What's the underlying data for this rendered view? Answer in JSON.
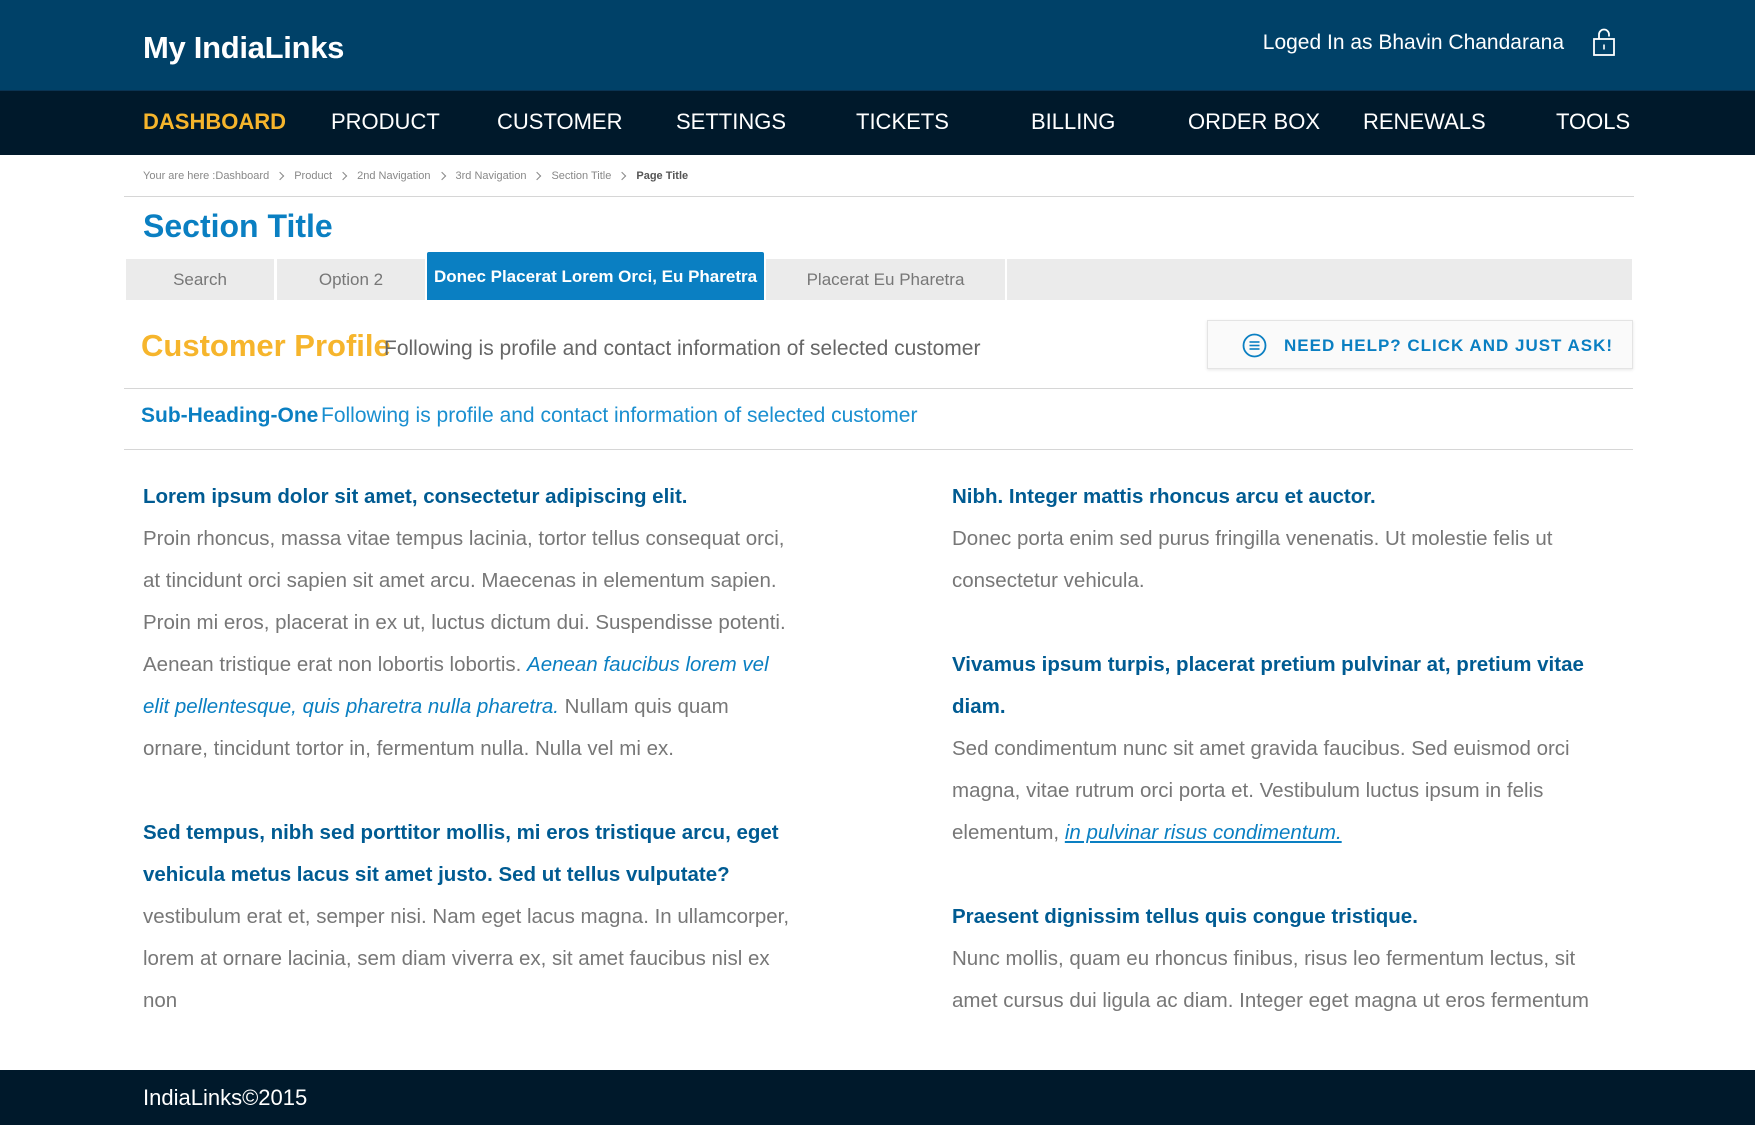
{
  "header": {
    "brand": "My IndiaLinks",
    "login_text": "Loged In as Bhavin Chandarana",
    "lock_icon": "lock-icon"
  },
  "nav": {
    "items": [
      {
        "label": "DASHBOARD",
        "active": true
      },
      {
        "label": "PRODUCT"
      },
      {
        "label": "CUSTOMER"
      },
      {
        "label": "SETTINGS"
      },
      {
        "label": "TICKETS"
      },
      {
        "label": "BILLING"
      },
      {
        "label": "ORDER BOX"
      },
      {
        "label": "RENEWALS"
      },
      {
        "label": "TOOLS"
      }
    ]
  },
  "breadcrumb": {
    "prefix": "Your are here : ",
    "items": [
      "Dashboard",
      "Product",
      "2nd Navigation",
      "3rd Navigation",
      "Section Title"
    ],
    "current": "Page Title"
  },
  "section_title": "Section Title",
  "tabs": [
    {
      "label": "Search"
    },
    {
      "label": "Option 2"
    },
    {
      "label": "Donec Placerat Lorem Orci, Eu Pharetra",
      "active": true
    },
    {
      "label": "Placerat Eu Pharetra"
    }
  ],
  "profile": {
    "title": "Customer Profile",
    "description": "Following is profile and contact information of selected customer",
    "help_label": "NEED HELP? CLICK AND JUST ASK!",
    "help_icon": "chat-list-icon"
  },
  "sub": {
    "heading": "Sub-Heading-One",
    "description": "Following is profile and contact information of selected customer"
  },
  "content": {
    "left": [
      {
        "heading": "Lorem ipsum dolor sit amet, consectetur adipiscing elit.",
        "text_before": "Proin rhoncus, massa vitae tempus lacinia, tortor tellus consequat orci, at tincidunt orci sapien sit amet arcu. Maecenas in elementum sapien. Proin mi eros, placerat in ex ut, luctus dictum dui. Suspendisse potenti. Aenean tristique erat non lobortis lobortis. ",
        "emphasis": "Aenean faucibus lorem vel elit pellentesque, quis pharetra nulla pharetra.",
        "text_after": " Nullam quis quam ornare, tincidunt tortor in, fermentum nulla. Nulla vel mi ex."
      },
      {
        "heading": "Sed tempus, nibh sed porttitor mollis, mi eros tristique arcu, eget vehicula metus lacus sit amet justo. Sed ut tellus vulputate?",
        "text": "vestibulum erat et, semper nisi. Nam eget lacus magna. In ullamcorper, lorem at ornare lacinia, sem diam viverra ex, sit amet faucibus nisl ex non"
      }
    ],
    "right": [
      {
        "heading": "Nibh. Integer mattis rhoncus arcu et auctor.",
        "text": "Donec porta enim sed purus fringilla venenatis. Ut molestie felis ut consectetur vehicula."
      },
      {
        "heading": "Vivamus ipsum turpis, placerat pretium pulvinar at, pretium vitae diam.",
        "text_before": "Sed condimentum nunc sit amet gravida faucibus. Sed euismod orci magna, vitae rutrum orci porta et. Vestibulum luctus ipsum in felis elementum, ",
        "link": "in pulvinar risus condimentum."
      },
      {
        "heading": "Praesent dignissim tellus quis congue tristique.",
        "text": "Nunc mollis, quam eu rhoncus finibus, risus leo fermentum lectus, sit amet cursus dui ligula ac diam. Integer eget magna ut eros fermentum"
      }
    ]
  },
  "footer": {
    "copyright": "IndiaLinks©2015"
  },
  "colors": {
    "header_bg": "#004168",
    "nav_bg": "#00192b",
    "accent_blue": "#0a7fc2",
    "accent_yellow": "#f6b52c",
    "heading_blue": "#005b92"
  }
}
